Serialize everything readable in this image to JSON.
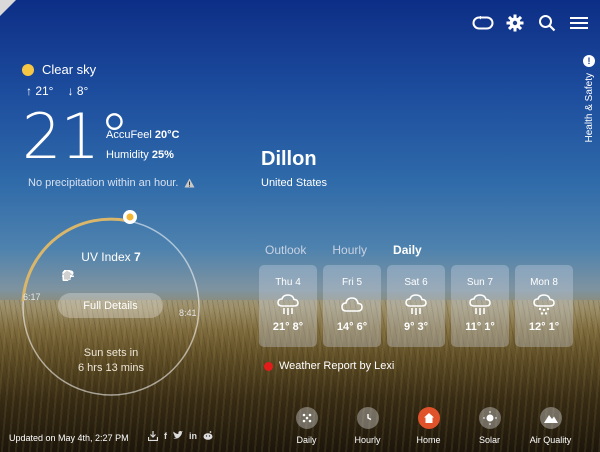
{
  "header": {
    "icons": [
      "sync-icon",
      "gear-icon",
      "search-icon",
      "menu-icon"
    ]
  },
  "side_tab": {
    "label": "Health & Safety",
    "alert": "!"
  },
  "current": {
    "condition": "Clear sky",
    "high": "↑ 21°",
    "low": "↓ 8°",
    "temp": "21°",
    "feel_label": "AccuFeel",
    "feel_value": "20°C",
    "humidity_label": "Humidity",
    "humidity_value": "25%",
    "precip": "No precipitation within an hour.",
    "colors": {
      "sun": "#f6c744",
      "arc": "#d9b66a"
    }
  },
  "uv": {
    "label": "UV Index",
    "value": "7",
    "button": "Full Details",
    "sunrise": "6:17",
    "sunset_time": "8:41",
    "sunset_line1": "Sun sets in",
    "sunset_line2": "6 hrs 13 mins",
    "icons": [
      "info-icon",
      "bottle-icon",
      "glasses-icon",
      "hat-icon",
      "shirt-icon",
      "umbrella-icon",
      "house-icon"
    ]
  },
  "location": {
    "city": "Dillon",
    "country": "United States"
  },
  "tabs": [
    "Outlook",
    "Hourly",
    "Daily"
  ],
  "active_tab": "Daily",
  "days": [
    {
      "label": "Thu 4",
      "icon": "rain-icon",
      "hilo": "21° 8°"
    },
    {
      "label": "Fri 5",
      "icon": "cloud-icon",
      "hilo": "14° 6°"
    },
    {
      "label": "Sat 6",
      "icon": "rain-icon",
      "hilo": "9° 3°"
    },
    {
      "label": "Sun 7",
      "icon": "rain-icon",
      "hilo": "11° 1°"
    },
    {
      "label": "Mon 8",
      "icon": "snow-icon",
      "hilo": "12° 1°"
    }
  ],
  "report": "Weather Report by Lexi",
  "footer": {
    "updated": "Updated on May 4th, 2:27 PM",
    "share_icons": [
      "download-icon",
      "facebook-icon",
      "twitter-icon",
      "linkedin-icon",
      "reddit-icon"
    ]
  },
  "nav": [
    {
      "label": "Daily",
      "icon": "grid-icon"
    },
    {
      "label": "Hourly",
      "icon": "clock-icon"
    },
    {
      "label": "Home",
      "icon": "home-icon"
    },
    {
      "label": "Solar",
      "icon": "sun-icon"
    },
    {
      "label": "Air Quality",
      "icon": "mountain-icon"
    }
  ],
  "active_nav": "Home"
}
